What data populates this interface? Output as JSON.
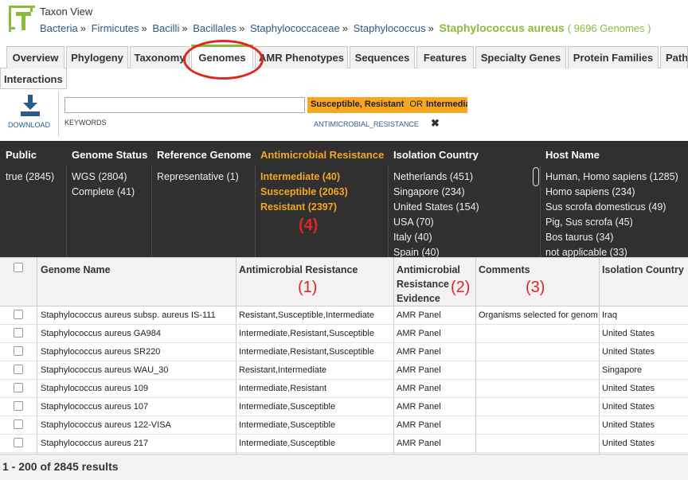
{
  "header": {
    "view_title": "Taxon View",
    "breadcrumb": [
      "Bacteria",
      "Firmicutes",
      "Bacilli",
      "Bacillales",
      "Staphylococcaceae",
      "Staphylococcus"
    ],
    "separator": "»",
    "current": "Staphylococcus aureus",
    "genome_count": "( 9696 Genomes )"
  },
  "tabs": [
    "Overview",
    "Phylogeny",
    "Taxonomy",
    "Genomes",
    "AMR Phenotypes",
    "Sequences",
    "Features",
    "Specialty Genes",
    "Protein Families",
    "Pathw"
  ],
  "active_tab": "Genomes",
  "tab_row2": "Interactions",
  "toolbar": {
    "download_label": "DOWNLOAD",
    "keywords_label": "KEYWORDS",
    "keywords_value": "",
    "filter_terms": [
      "Susceptible",
      "Resistant",
      "Intermedia"
    ],
    "filter_comma": ",",
    "filter_or": "OR",
    "filter_field": "ANTIMICROBIAL_RESISTANCE",
    "filter_remove": "✖"
  },
  "facets": {
    "public": {
      "header": "Public",
      "items": [
        "true (2845)"
      ]
    },
    "genome_status": {
      "header": "Genome Status",
      "items": [
        "WGS (2804)",
        "Complete (41)"
      ]
    },
    "reference_genome": {
      "header": "Reference Genome",
      "items": [
        "Representative (1)"
      ]
    },
    "amr": {
      "header": "Antimicrobial Resistance",
      "items": [
        "Intermediate (40)",
        "Susceptible (2063)",
        "Resistant (2397)"
      ]
    },
    "isolation_country": {
      "header": "Isolation Country",
      "items": [
        "Netherlands (451)",
        "Singapore (234)",
        "United States (154)",
        "USA (70)",
        "Italy (40)",
        "Spain (40)"
      ]
    },
    "host_name": {
      "header": "Host Name",
      "items": [
        "Human, Homo sapiens (1285)",
        "Homo sapiens (234)",
        "Sus scrofa domesticus (49)",
        "Pig, Sus scrofa (45)",
        "Bos taurus (34)",
        "not applicable (33)"
      ]
    }
  },
  "annotations": {
    "a1": "(1)",
    "a2": "(2)",
    "a3": "(3)",
    "a4": "(4)"
  },
  "grid": {
    "columns": [
      "Genome Name",
      "Antimicrobial Resistance",
      "Antimicrobial Resistance Evidence",
      "Comments",
      "Isolation Country"
    ],
    "evidence_lines": [
      "Antimicrobial",
      "Resistance",
      "Evidence"
    ],
    "rows": [
      [
        "Staphylococcus aureus subsp. aureus IS-111",
        "Resistant,Susceptible,Intermediate",
        "AMR Panel",
        "Organisms selected for genom",
        "Iraq"
      ],
      [
        "Staphylococcus aureus GA984",
        "Intermediate,Resistant,Susceptible",
        "AMR Panel",
        "",
        "United States"
      ],
      [
        "Staphylococcus aureus SR220",
        "Intermediate,Resistant,Susceptible",
        "AMR Panel",
        "",
        "United States"
      ],
      [
        "Staphylococcus aureus WAU_30",
        "Resistant,Intermediate",
        "AMR Panel",
        "",
        "Singapore"
      ],
      [
        "Staphylococcus aureus 109",
        "Intermediate,Resistant",
        "AMR Panel",
        "",
        "United States"
      ],
      [
        "Staphylococcus aureus 107",
        "Intermediate,Susceptible",
        "AMR Panel",
        "",
        "United States"
      ],
      [
        "Staphylococcus aureus 122-VISA",
        "Intermediate,Susceptible",
        "AMR Panel",
        "",
        "United States"
      ],
      [
        "Staphylococcus aureus 217",
        "Intermediate,Susceptible",
        "AMR Panel",
        "",
        "United States"
      ]
    ]
  },
  "footer": {
    "results": "1 - 200 of 2845 results"
  },
  "colors": {
    "accent_green": "#8cba3c",
    "accent_orange": "#f5a623",
    "annotation_red": "#e0271f",
    "panel_bg": "#303030"
  }
}
